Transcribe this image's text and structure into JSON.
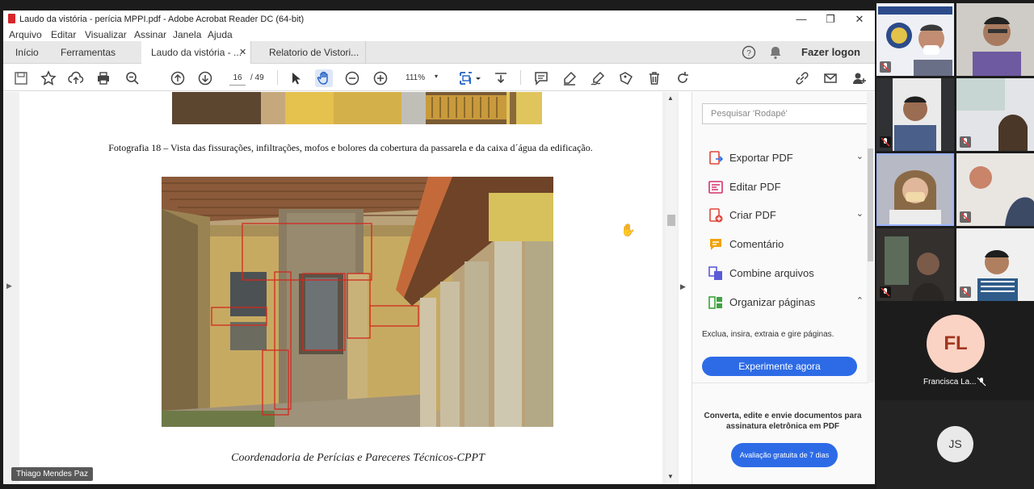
{
  "window": {
    "title": "Laudo da vistória - perícia MPPI.pdf - Adobe Acrobat Reader DC (64-bit)",
    "minimize": "—",
    "maximize": "❐",
    "close": "✕"
  },
  "menu": [
    "Arquivo",
    "Editar",
    "Visualizar",
    "Assinar",
    "Janela",
    "Ajuda"
  ],
  "tabs": {
    "home": "Início",
    "tools": "Ferramentas",
    "documents": [
      {
        "label": "Laudo da vistória - ...",
        "active": true
      },
      {
        "label": "Relatorio de Vistori...",
        "active": false
      }
    ],
    "close_glyph": "✕",
    "login": "Fazer logon"
  },
  "toolbar": {
    "current_page": "16",
    "total_pages": "/ 49",
    "zoom": "111%",
    "zoom_caret": "▾",
    "icons": [
      "save-icon",
      "bookmark-star-icon",
      "upload-cloud-icon",
      "print-icon",
      "zoom-search-icon",
      "page-up-icon",
      "page-down-icon",
      "select-arrow-icon",
      "hand-icon",
      "zoom-out-icon",
      "zoom-in-icon",
      "fit-page-icon",
      "scroll-mode-icon",
      "comment-icon",
      "highlight-pen-icon",
      "sign-icon",
      "stamp-icon",
      "delete-icon",
      "rotate-icon",
      "share-link-icon",
      "email-icon",
      "add-user-icon"
    ]
  },
  "document": {
    "caption": "Fotografia 18 – Vista das fissurações, infiltrações, mofos e bolores da cobertura da passarela e da caixa d´água da edificação.",
    "footer": "Coordenadoria de Perícias e Pareceres Técnicos-CPPT"
  },
  "tools_pane": {
    "search_placeholder": "Pesquisar 'Rodapé'",
    "items": [
      {
        "label": "Exportar PDF",
        "icon": "export-pdf-icon",
        "chevron": "⌄",
        "color": "#e0463b"
      },
      {
        "label": "Editar PDF",
        "icon": "edit-pdf-icon",
        "chevron": "",
        "color": "#d6336c"
      },
      {
        "label": "Criar PDF",
        "icon": "create-pdf-icon",
        "chevron": "⌄",
        "color": "#e0463b"
      },
      {
        "label": "Comentário",
        "icon": "comment-tool-icon",
        "chevron": "",
        "color": "#f0a30a"
      },
      {
        "label": "Combine arquivos",
        "icon": "combine-files-icon",
        "chevron": "",
        "color": "#5b5bd6"
      },
      {
        "label": "Organizar páginas",
        "icon": "organize-pages-icon",
        "chevron": "⌃",
        "color": "#3fa33f"
      }
    ],
    "organize_description": "Exclua, insira, extraia e gire páginas.",
    "try_button": "Experimente agora",
    "promo": "Converta, edite e envie documentos para assinatura eletrônica em PDF",
    "trial_button": "Avaliação gratuita de 7 dias"
  },
  "meeting": {
    "presenter_name": "Thiago Mendes Paz",
    "participants": [
      {
        "initials": "FL",
        "name": "Francisca La..."
      },
      {
        "initials": "JS",
        "name": ""
      }
    ]
  }
}
